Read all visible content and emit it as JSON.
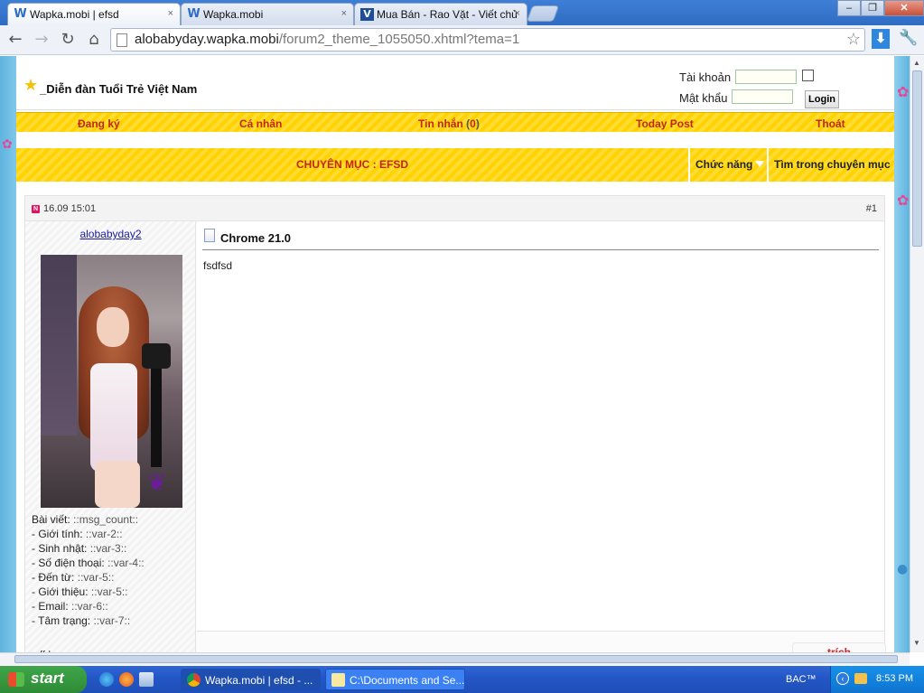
{
  "browser": {
    "tabs": [
      {
        "label": "Wapka.mobi | efsd",
        "icon": "W",
        "active": true
      },
      {
        "label": "Wapka.mobi",
        "icon": "W",
        "active": false
      },
      {
        "label": "Mua Bán - Rao Vặt - Viết chủ",
        "icon": "V",
        "active": false
      }
    ],
    "close_glyph": "×",
    "window_buttons": {
      "minimize": "–",
      "maximize": "❐",
      "close": "✕"
    },
    "url_host": "alobabyday.wapka.mobi",
    "url_rest": "/forum2_theme_1055050.xhtml?tema=1"
  },
  "site": {
    "name": "_Diễn đàn Tuổi Trẻ Việt Nam",
    "login": {
      "username_label": "Tài khoản",
      "password_label": "Mật khẩu",
      "button": "Login"
    },
    "menu": {
      "register": "Đang ký",
      "profile": "Cá nhân",
      "messages": "Tin nhắn",
      "messages_count": "0",
      "today_post": "Today Post",
      "logout": "Thoát"
    },
    "category": {
      "title": "CHUYÊN MỤC : EFSD",
      "functions": "Chức năng",
      "search": "Tìm trong chuyên mục"
    }
  },
  "post": {
    "badge": "N",
    "date": "16.09 15:01",
    "number": "#1",
    "username": "alobabyday2",
    "title": "Chrome 21.0",
    "body": "fsdfsd",
    "user_fields": [
      {
        "label": "Bài viết:",
        "value": "::msg_count::"
      },
      {
        "label": "- Giới tính:",
        "value": "::var-2::"
      },
      {
        "label": "- Sinh nhật:",
        "value": "::var-3::"
      },
      {
        "label": "- Số điện thoại:",
        "value": "::var-4::"
      },
      {
        "label": "- Đến từ:",
        "value": "::var-5::"
      },
      {
        "label": "- Giới thiệu:",
        "value": "::var-5::"
      },
      {
        "label": "- Email:",
        "value": "::var-6::"
      },
      {
        "label": "- Tâm trạng:",
        "value": "::var-7::"
      }
    ],
    "quote_label": "trích",
    "signature": "ffd"
  },
  "taskbar": {
    "start": "start",
    "tasks": [
      {
        "label": "Wapka.mobi | efsd - ...",
        "active": false
      },
      {
        "label": "C:\\Documents and Se...",
        "active": false
      }
    ],
    "language": "BAC™",
    "clock": "8:53 PM"
  },
  "colors": {
    "accent_yellow": "#ffd200",
    "link_red": "#c0280c",
    "taskbar_blue": "#2457c7",
    "start_green": "#3fa64a"
  }
}
